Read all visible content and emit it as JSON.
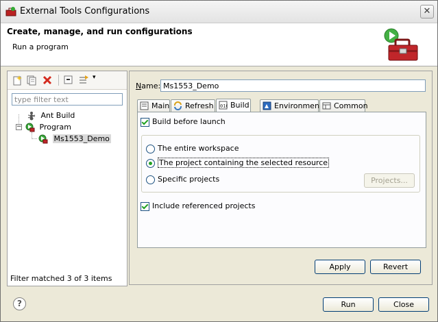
{
  "window": {
    "title": "External Tools Configurations",
    "close_label": "✕"
  },
  "header": {
    "title": "Create, manage, and run configurations",
    "subtitle": "Run a program"
  },
  "left": {
    "filter_placeholder": "type filter text",
    "tree": [
      {
        "label": "Ant Build",
        "icon": "ant-icon",
        "level": 1
      },
      {
        "label": "Program",
        "icon": "program-icon",
        "level": 1,
        "expanded": true
      },
      {
        "label": "Ms1553_Demo",
        "icon": "program-config-icon",
        "level": 2,
        "selected": true
      }
    ],
    "status": "Filter matched 3 of 3 items",
    "toolbar_icons": [
      "new-config-icon",
      "duplicate-icon",
      "delete-icon",
      "collapse-all-icon",
      "filter-icon"
    ]
  },
  "right": {
    "name_label": "Name:",
    "name_value": "Ms1553_Demo",
    "tabs": [
      {
        "label": "Main",
        "icon": "main-tab-icon"
      },
      {
        "label": "Refresh",
        "icon": "refresh-tab-icon"
      },
      {
        "label": "Build",
        "icon": "build-tab-icon",
        "active": true
      },
      {
        "label": "Environment",
        "icon": "environment-tab-icon"
      },
      {
        "label": "Common",
        "icon": "common-tab-icon"
      }
    ],
    "build_before_launch": "Build before launch",
    "radios": [
      {
        "label": "The entire workspace",
        "checked": false
      },
      {
        "label": "The project containing the selected resource",
        "checked": true
      },
      {
        "label": "Specific projects",
        "checked": false
      }
    ],
    "projects_button": "Projects...",
    "include_referenced": "Include referenced projects",
    "apply_button": "Apply",
    "revert_button": "Revert"
  },
  "footer": {
    "run_button": "Run",
    "close_button": "Close",
    "help": "?"
  },
  "colors": {
    "dialog_bg": "#ece9d8",
    "check_green": "#21a121",
    "delete_red": "#d42a1e"
  }
}
